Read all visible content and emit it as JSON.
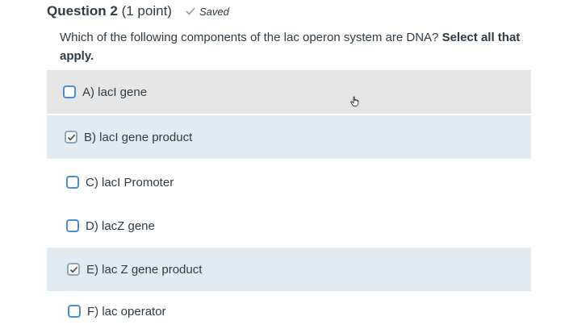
{
  "question": {
    "title": "Question 2",
    "points": "(1 point)",
    "saved_label": "Saved",
    "prompt_text": "Which of the following components of the lac operon system are DNA?",
    "prompt_emphasis": "Select all that apply."
  },
  "options": [
    {
      "label": "A) lacI gene",
      "checked": false
    },
    {
      "label": "B) lacI gene product",
      "checked": true
    },
    {
      "label": "C) lacI Promoter",
      "checked": false
    },
    {
      "label": "D) lacZ gene",
      "checked": false
    },
    {
      "label": "E) lac Z gene product",
      "checked": true
    },
    {
      "label": "F) lac operator",
      "checked": false
    }
  ],
  "icons": {
    "saved": "checkmark-icon",
    "checkbox_checked": "checkmark-icon",
    "cursor": "hand-pointer-icon"
  },
  "colors": {
    "text": "#2d3b45",
    "checkbox_border": "#4c8fd0",
    "selected_bg": "#e2ebf1",
    "hover_bg": "#e6e6e6"
  }
}
